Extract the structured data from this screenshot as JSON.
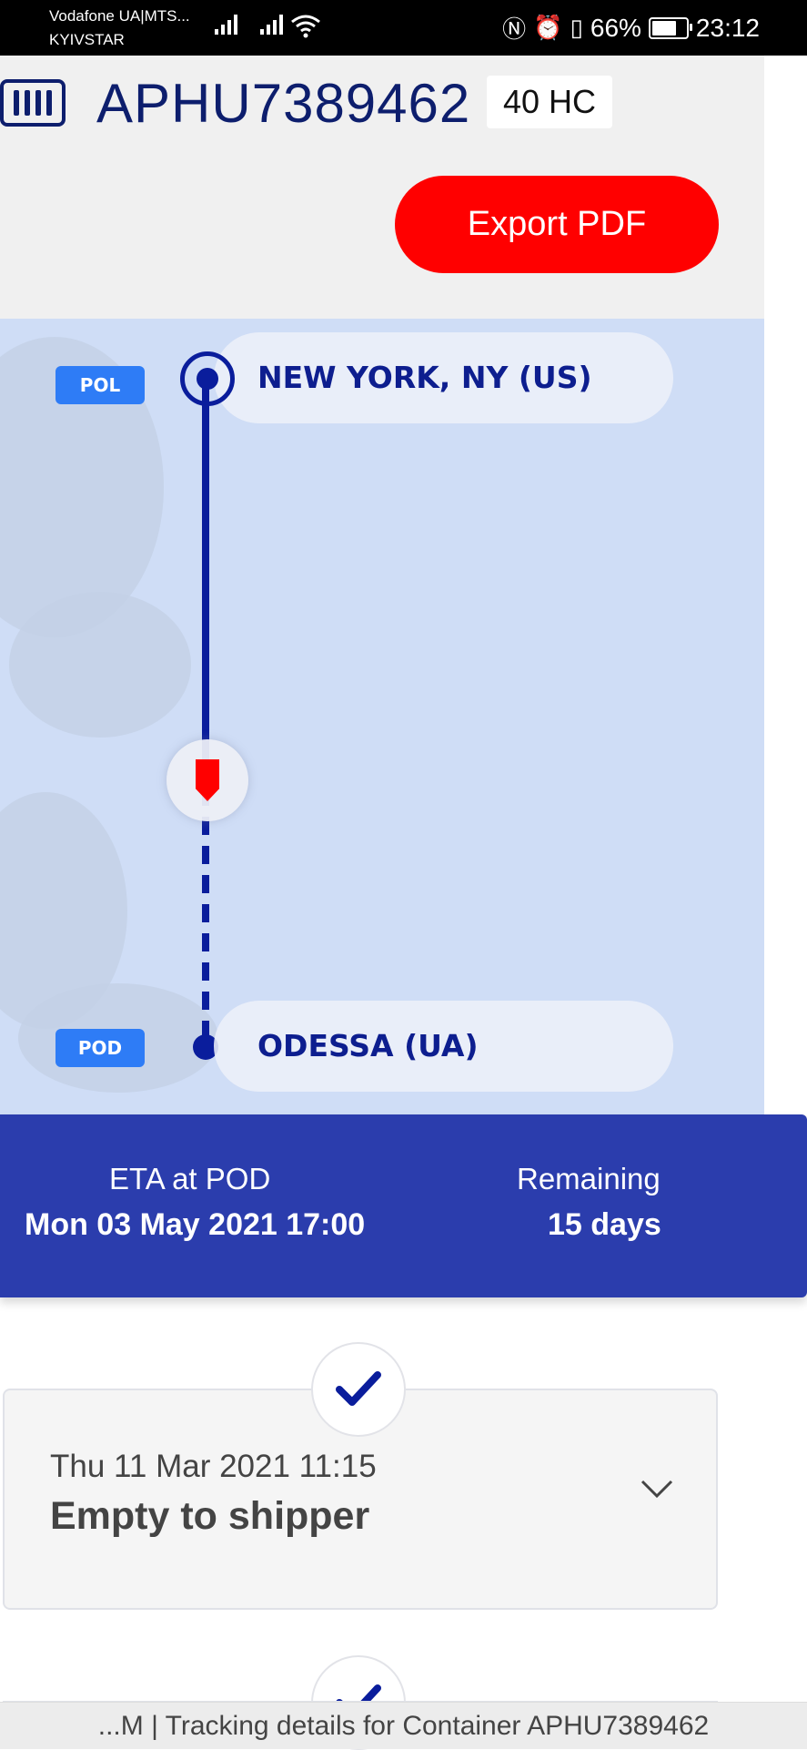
{
  "status_bar": {
    "carrier_line1": "Vodafone UA|MTS...",
    "carrier_line2": "KYIVSTAR",
    "battery": "66%",
    "time": "23:12"
  },
  "header": {
    "container_number": "APHU7389462",
    "container_type": "40 HC",
    "export_label": "Export PDF"
  },
  "route": {
    "pol_badge": "POL",
    "pol_name": "NEW YORK, NY (US)",
    "pod_badge": "POD",
    "pod_name": "ODESSA (UA)"
  },
  "eta": {
    "label": "ETA at POD",
    "value": "Mon 03 May 2021 17:00",
    "remaining_label": "Remaining",
    "remaining_value": "15 days"
  },
  "events": [
    {
      "date": "Thu 11 Mar 2021 11:15",
      "title": "Empty to shipper"
    }
  ],
  "footer": {
    "page_title": "...M | Tracking details for Container APHU7389462"
  },
  "colors": {
    "primary_navy": "#0d1e6d",
    "route_blue": "#0a1d9c",
    "accent_red": "#ff0000",
    "badge_blue": "#2e7cf6",
    "eta_bar": "#2b3dad"
  },
  "icons": [
    "container-icon",
    "vessel-icon",
    "check-icon",
    "chevron-down-icon",
    "wifi-icon",
    "signal-icon",
    "battery-icon",
    "alarm-icon",
    "nfc-icon",
    "vibrate-icon"
  ]
}
